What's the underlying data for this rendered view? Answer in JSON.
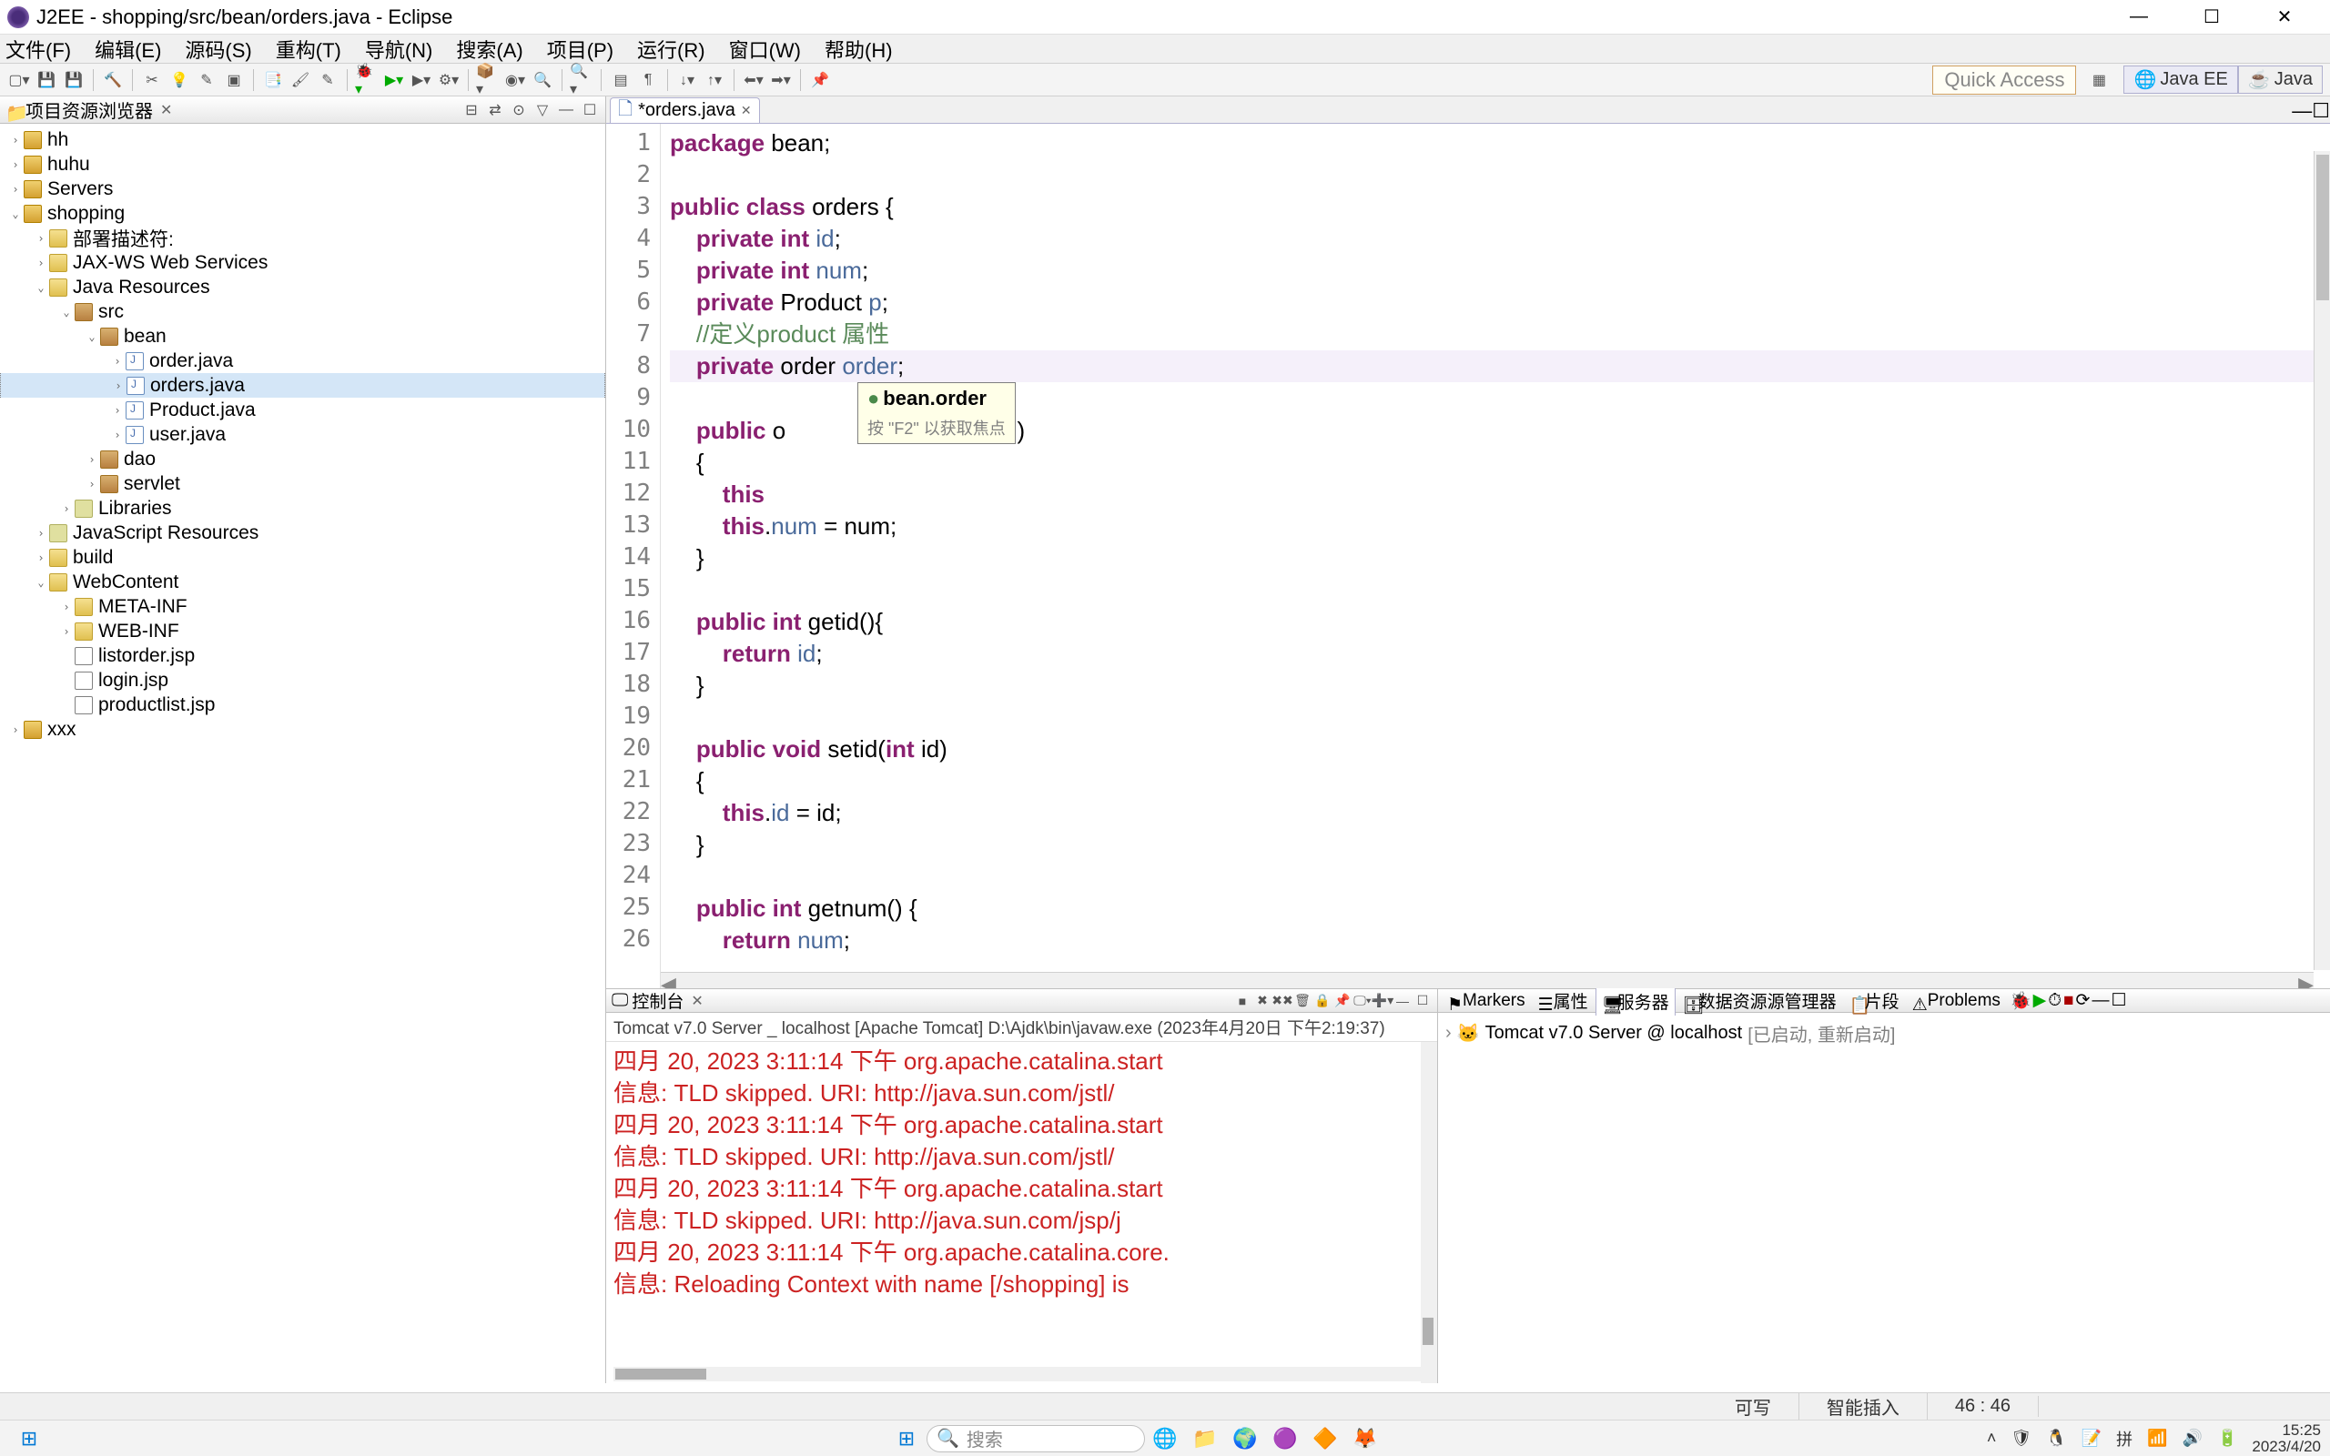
{
  "window": {
    "title": "J2EE - shopping/src/bean/orders.java - Eclipse",
    "minimize": "—",
    "maximize": "☐",
    "close": "✕"
  },
  "menubar": [
    "文件(F)",
    "编辑(E)",
    "源码(S)",
    "重构(T)",
    "导航(N)",
    "搜索(A)",
    "项目(P)",
    "运行(R)",
    "窗口(W)",
    "帮助(H)"
  ],
  "quick_access": "Quick Access",
  "perspectives": [
    {
      "label": "Java EE",
      "active": true
    },
    {
      "label": "Java",
      "active": false
    }
  ],
  "project_explorer": {
    "title": "项目资源浏览器",
    "tree": [
      {
        "label": "hh",
        "depth": 0,
        "icon": "project",
        "expander": "›"
      },
      {
        "label": "huhu",
        "depth": 0,
        "icon": "project",
        "expander": "›"
      },
      {
        "label": "Servers",
        "depth": 0,
        "icon": "project",
        "expander": "›"
      },
      {
        "label": "shopping",
        "depth": 0,
        "icon": "project",
        "expander": "⌄"
      },
      {
        "label": "部署描述符:",
        "depth": 1,
        "icon": "folder",
        "expander": "›"
      },
      {
        "label": "JAX-WS Web Services",
        "depth": 1,
        "icon": "folder",
        "expander": "›"
      },
      {
        "label": "Java Resources",
        "depth": 1,
        "icon": "folder",
        "expander": "⌄"
      },
      {
        "label": "src",
        "depth": 2,
        "icon": "package",
        "expander": "⌄"
      },
      {
        "label": "bean",
        "depth": 3,
        "icon": "package",
        "expander": "⌄"
      },
      {
        "label": "order.java",
        "depth": 4,
        "icon": "java",
        "expander": "›"
      },
      {
        "label": "orders.java",
        "depth": 4,
        "icon": "java",
        "expander": "›",
        "selected": true
      },
      {
        "label": "Product.java",
        "depth": 4,
        "icon": "java",
        "expander": "›"
      },
      {
        "label": "user.java",
        "depth": 4,
        "icon": "java",
        "expander": "›"
      },
      {
        "label": "dao",
        "depth": 3,
        "icon": "package",
        "expander": "›"
      },
      {
        "label": "servlet",
        "depth": 3,
        "icon": "package",
        "expander": "›"
      },
      {
        "label": "Libraries",
        "depth": 2,
        "icon": "lib",
        "expander": "›"
      },
      {
        "label": "JavaScript Resources",
        "depth": 1,
        "icon": "lib",
        "expander": "›"
      },
      {
        "label": "build",
        "depth": 1,
        "icon": "folder",
        "expander": "›"
      },
      {
        "label": "WebContent",
        "depth": 1,
        "icon": "folder",
        "expander": "⌄"
      },
      {
        "label": "META-INF",
        "depth": 2,
        "icon": "folder",
        "expander": "›"
      },
      {
        "label": "WEB-INF",
        "depth": 2,
        "icon": "folder",
        "expander": "›"
      },
      {
        "label": "listorder.jsp",
        "depth": 2,
        "icon": "jsp",
        "expander": ""
      },
      {
        "label": "login.jsp",
        "depth": 2,
        "icon": "jsp",
        "expander": ""
      },
      {
        "label": "productlist.jsp",
        "depth": 2,
        "icon": "jsp",
        "expander": ""
      },
      {
        "label": "xxx",
        "depth": 0,
        "icon": "project",
        "expander": "›"
      }
    ]
  },
  "editor": {
    "tab_label": "*orders.java",
    "tooltip_main": "bean.order",
    "tooltip_sub": "按 \"F2\" 以获取焦点",
    "lines": [
      {
        "n": 1,
        "html": "<span class='kw'>package</span> bean;"
      },
      {
        "n": 2,
        "html": ""
      },
      {
        "n": 3,
        "html": "<span class='kw'>public class</span> orders {"
      },
      {
        "n": 4,
        "html": "    <span class='kw'>private int</span> <span class='field'>id</span>;"
      },
      {
        "n": 5,
        "html": "    <span class='kw'>private int</span> <span class='field'>num</span>;"
      },
      {
        "n": 6,
        "html": "    <span class='kw'>private</span> Product <span class='field'>p</span>;"
      },
      {
        "n": 7,
        "html": "    <span class='comment'>//定义product 属性</span>"
      },
      {
        "n": 8,
        "html": "    <span class='kw'>private</span> order <span class='field'>order</span>;",
        "hl": true
      },
      {
        "n": 9,
        "html": ""
      },
      {
        "n": 10,
        "html": "    <span class='kw'>public</span> o            duct <span class='field'>p</span>,<span class='kw'>int</span> num)"
      },
      {
        "n": 11,
        "html": "    {"
      },
      {
        "n": 12,
        "html": "        <span class='kw'>this</span>"
      },
      {
        "n": 13,
        "html": "        <span class='kw'>this</span>.<span class='field'>num</span> = num;"
      },
      {
        "n": 14,
        "html": "    }"
      },
      {
        "n": 15,
        "html": ""
      },
      {
        "n": 16,
        "html": "    <span class='kw'>public int</span> getid(){"
      },
      {
        "n": 17,
        "html": "        <span class='kw'>return</span> <span class='field'>id</span>;"
      },
      {
        "n": 18,
        "html": "    }"
      },
      {
        "n": 19,
        "html": ""
      },
      {
        "n": 20,
        "html": "    <span class='kw'>public void</span> setid(<span class='kw'>int</span> id)"
      },
      {
        "n": 21,
        "html": "    {"
      },
      {
        "n": 22,
        "html": "        <span class='kw'>this</span>.<span class='field'>id</span> = id;"
      },
      {
        "n": 23,
        "html": "    }"
      },
      {
        "n": 24,
        "html": ""
      },
      {
        "n": 25,
        "html": "    <span class='kw'>public int</span> getnum() {"
      },
      {
        "n": 26,
        "html": "        <span class='kw'>return</span> <span class='field'>num</span>;"
      }
    ]
  },
  "console": {
    "title": "控制台",
    "desc": "Tomcat v7.0 Server _ localhost [Apache Tomcat] D:\\Ajdk\\bin\\javaw.exe  (2023年4月20日 下午2:19:37)",
    "lines": [
      "四月 20, 2023 3:11:14 下午 org.apache.catalina.start",
      "信息: TLD skipped. URI: http://java.sun.com/jstl/",
      "四月 20, 2023 3:11:14 下午 org.apache.catalina.start",
      "信息: TLD skipped. URI: http://java.sun.com/jstl/",
      "四月 20, 2023 3:11:14 下午 org.apache.catalina.start",
      "信息: TLD skipped. URI: http://java.sun.com/jsp/j",
      "四月 20, 2023 3:11:14 下午 org.apache.catalina.core.",
      "信息: Reloading Context with name [/shopping] is "
    ]
  },
  "right_panel": {
    "tabs": [
      "Markers",
      "属性",
      "服务器",
      "数据资源源管理器",
      "片段",
      "Problems"
    ],
    "active_tab_index": 2,
    "server_name": "Tomcat v7.0 Server @ localhost",
    "server_status": "[已启动, 重新启动]"
  },
  "status_bar": {
    "writable": "可写",
    "insert": "智能插入",
    "cursor": "46 : 46"
  },
  "taskbar": {
    "search_placeholder": "搜索",
    "time": "15:25",
    "date": "2023/4/20"
  }
}
